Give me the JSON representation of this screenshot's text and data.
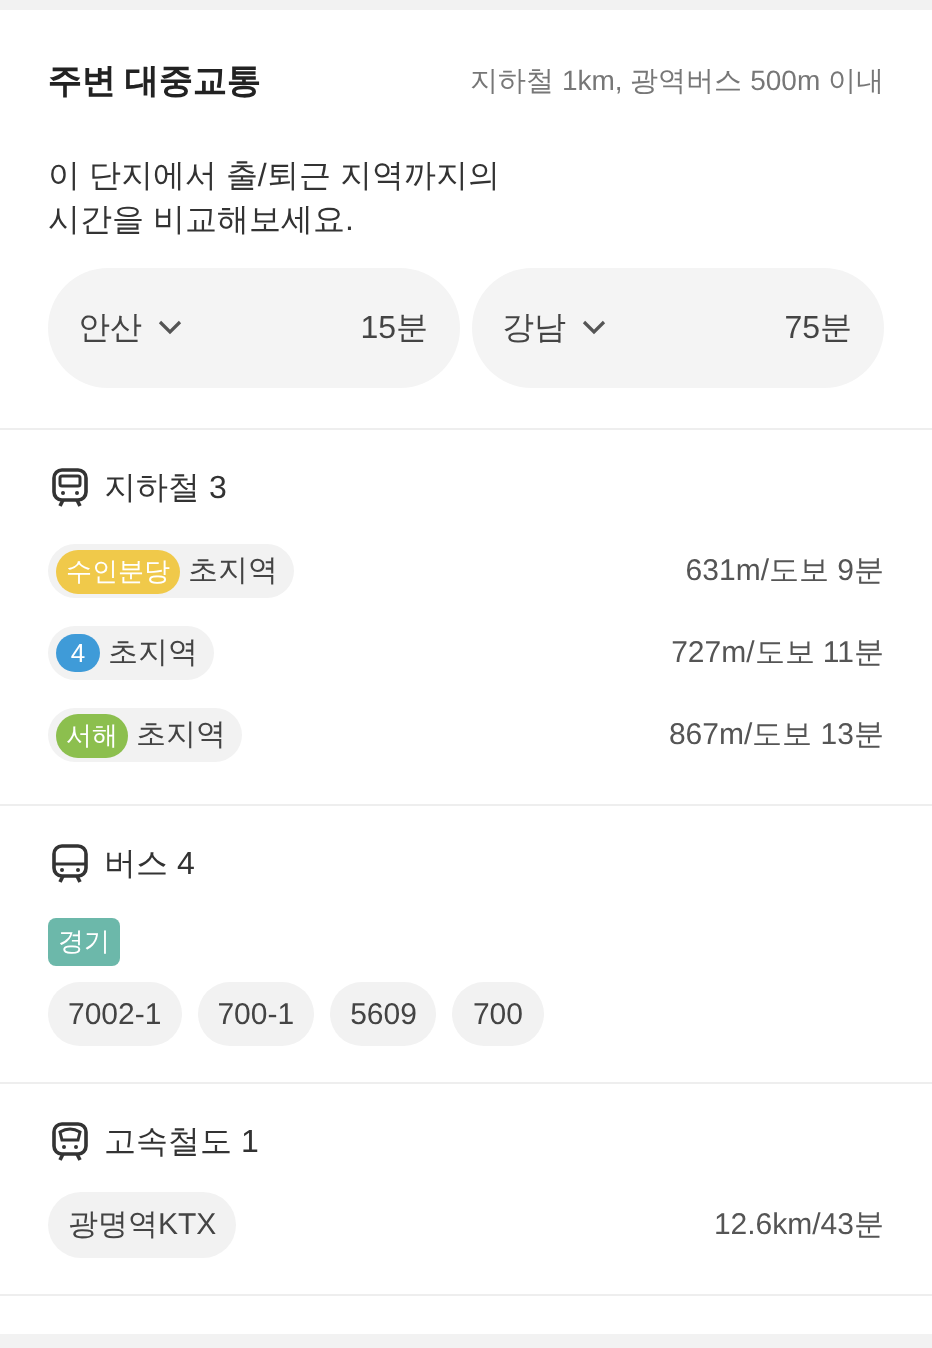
{
  "header": {
    "title": "주변 대중교통",
    "subtitle": "지하철 1km, 광역버스 500m 이내"
  },
  "description": "이 단지에서 출/퇴근 지역까지의\n시간을 비교해보세요.",
  "commutes": [
    {
      "region": "안산",
      "time": "15분"
    },
    {
      "region": "강남",
      "time": "75분"
    }
  ],
  "sections": [
    {
      "kind": "subway",
      "title": "지하철 3",
      "stations": [
        {
          "line": "수인분당",
          "color": "#f0c94a",
          "name": "초지역",
          "distance": "631m/도보 9분"
        },
        {
          "line": "4",
          "color": "#3f9bd8",
          "name": "초지역",
          "distance": "727m/도보 11분"
        },
        {
          "line": "서해",
          "color": "#8cbf4e",
          "name": "초지역",
          "distance": "867m/도보 13분"
        }
      ]
    },
    {
      "kind": "bus",
      "title": "버스 4",
      "region_tag": "경기",
      "routes": [
        "7002-1",
        "700-1",
        "5609",
        "700"
      ]
    },
    {
      "kind": "rail",
      "title": "고속철도 1",
      "stations": [
        {
          "name": "광명역KTX",
          "distance": "12.6km/43분"
        }
      ]
    }
  ]
}
